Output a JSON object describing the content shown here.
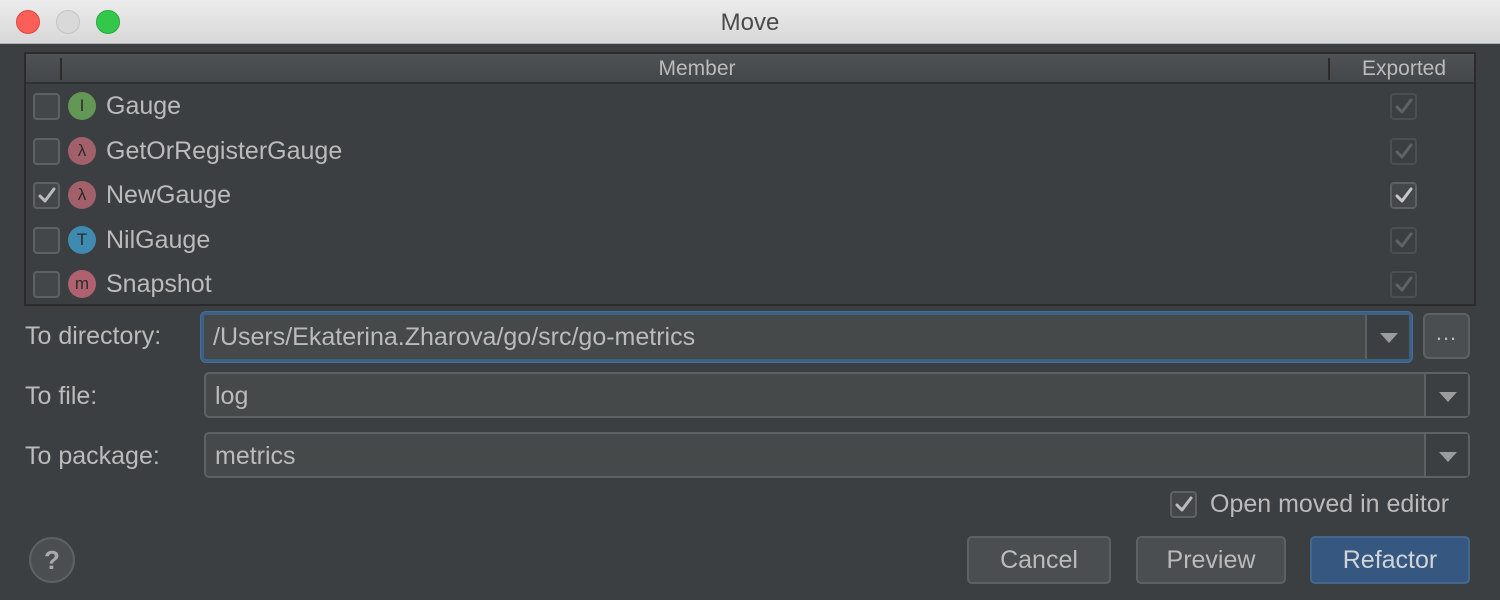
{
  "window": {
    "title": "Move",
    "controls": [
      "close",
      "minimize",
      "maximize"
    ]
  },
  "members_table": {
    "columns": {
      "member": "Member",
      "exported": "Exported"
    },
    "rows": [
      {
        "name": "Gauge",
        "kind": "interface",
        "icon_letter": "I",
        "icon_color": "#629755",
        "selected": false,
        "exported": true,
        "exported_enabled": false
      },
      {
        "name": "GetOrRegisterGauge",
        "kind": "function",
        "icon_letter": "λ",
        "icon_color": "#a2606a",
        "selected": false,
        "exported": true,
        "exported_enabled": false
      },
      {
        "name": "NewGauge",
        "kind": "function",
        "icon_letter": "λ",
        "icon_color": "#a2606a",
        "selected": true,
        "exported": true,
        "exported_enabled": true
      },
      {
        "name": "NilGauge",
        "kind": "type",
        "icon_letter": "T",
        "icon_color": "#3f8ab0",
        "selected": false,
        "exported": true,
        "exported_enabled": false
      },
      {
        "name": "Snapshot",
        "kind": "method",
        "icon_letter": "m",
        "icon_color": "#b0616f",
        "selected": false,
        "exported": true,
        "exported_enabled": false
      }
    ]
  },
  "form": {
    "to_directory": {
      "label": "To directory:",
      "value": "/Users/Ekaterina.Zharova/go/src/go-metrics",
      "browse_label": "..."
    },
    "to_file": {
      "label": "To file:",
      "value": "log"
    },
    "to_package": {
      "label": "To package:",
      "value": "metrics"
    }
  },
  "options": {
    "open_moved_in_editor": {
      "label": "Open moved in editor",
      "checked": true
    }
  },
  "buttons": {
    "help": "?",
    "cancel": "Cancel",
    "preview": "Preview",
    "refactor": "Refactor"
  },
  "colors": {
    "accent": "#365880",
    "focus_ring": "#3d6185",
    "background": "#3c3f41"
  }
}
